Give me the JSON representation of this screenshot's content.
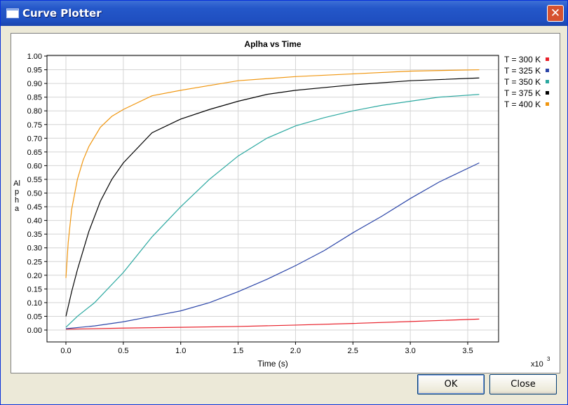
{
  "window": {
    "title": "Curve Plotter",
    "close_glyph": "✕"
  },
  "buttons": {
    "ok": "OK",
    "close": "Close"
  },
  "chart_data": {
    "type": "line",
    "title": "Aplha vs Time",
    "xlabel": "Time (s)",
    "ylabel": "Alpha",
    "x_multiplier": "x10",
    "x_multiplier_exp": "3",
    "xlim": [
      -0.16,
      3.75
    ],
    "ylim": [
      -0.1,
      1.0
    ],
    "xticks": [
      0.0,
      0.5,
      1.0,
      1.5,
      2.0,
      2.5,
      3.0,
      3.5
    ],
    "yticks": [
      0.0,
      0.05,
      0.1,
      0.15,
      0.2,
      0.25,
      0.3,
      0.35,
      0.4,
      0.45,
      0.5,
      0.55,
      0.6,
      0.65,
      0.7,
      0.75,
      0.8,
      0.85,
      0.9,
      0.95,
      1.0
    ],
    "grid": true,
    "legend": "right",
    "series": [
      {
        "name": "T = 300 K",
        "color": "#e8202a",
        "x": [
          0,
          0.5,
          1,
          1.5,
          2,
          2.5,
          3,
          3.6
        ],
        "y": [
          0.003,
          0.007,
          0.01,
          0.013,
          0.018,
          0.024,
          0.031,
          0.04
        ]
      },
      {
        "name": "T = 325 K",
        "color": "#2b45a8",
        "x": [
          0,
          0.25,
          0.5,
          0.75,
          1,
          1.25,
          1.5,
          1.75,
          2,
          2.25,
          2.5,
          2.75,
          3,
          3.25,
          3.6
        ],
        "y": [
          0.005,
          0.015,
          0.03,
          0.05,
          0.07,
          0.1,
          0.14,
          0.185,
          0.235,
          0.29,
          0.355,
          0.415,
          0.48,
          0.54,
          0.61
        ]
      },
      {
        "name": "T = 350 K",
        "color": "#2aa8a0",
        "x": [
          0,
          0.1,
          0.25,
          0.5,
          0.75,
          1,
          1.25,
          1.5,
          1.75,
          2,
          2.25,
          2.5,
          2.75,
          3,
          3.25,
          3.6
        ],
        "y": [
          0.01,
          0.05,
          0.1,
          0.21,
          0.34,
          0.45,
          0.55,
          0.635,
          0.7,
          0.745,
          0.775,
          0.8,
          0.82,
          0.835,
          0.85,
          0.86
        ]
      },
      {
        "name": "T = 375 K",
        "color": "#000000",
        "x": [
          0,
          0.05,
          0.1,
          0.2,
          0.3,
          0.4,
          0.5,
          0.75,
          1,
          1.25,
          1.5,
          1.75,
          2,
          2.5,
          3,
          3.6
        ],
        "y": [
          0.05,
          0.14,
          0.22,
          0.36,
          0.47,
          0.55,
          0.61,
          0.72,
          0.77,
          0.805,
          0.835,
          0.86,
          0.875,
          0.895,
          0.91,
          0.92
        ]
      },
      {
        "name": "T = 400 K",
        "color": "#f0960f",
        "x": [
          0,
          0.02,
          0.05,
          0.1,
          0.15,
          0.2,
          0.3,
          0.4,
          0.5,
          0.75,
          1,
          1.5,
          2,
          2.5,
          3,
          3.6
        ],
        "y": [
          0.19,
          0.32,
          0.44,
          0.55,
          0.62,
          0.67,
          0.74,
          0.78,
          0.805,
          0.855,
          0.875,
          0.91,
          0.925,
          0.935,
          0.945,
          0.95
        ]
      }
    ]
  }
}
